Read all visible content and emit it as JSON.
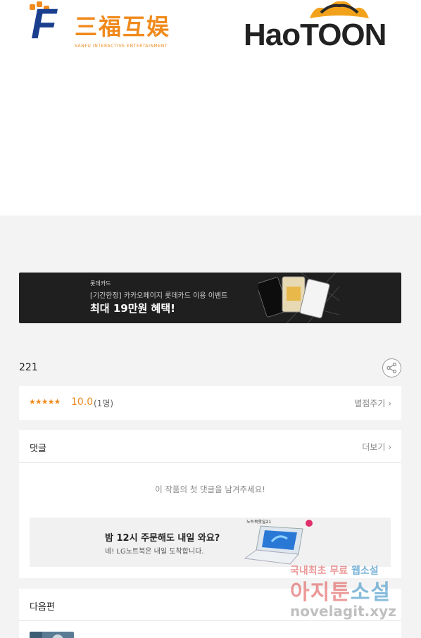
{
  "logos": {
    "sanfu": {
      "mark": "F",
      "name": "三福互娱",
      "tagline": "SANFU INTERACTIVE ENTERTAINMENT"
    },
    "haotoon": {
      "name": "HaoTOON"
    }
  },
  "banner": {
    "brand": "롯데카드",
    "subtitle": "[기간한정] 카카오페이지 롯데카드 이용 이벤트",
    "headline": "최대 19만원 혜택!"
  },
  "episode": {
    "title": "221"
  },
  "rating": {
    "stars": "★★★★★",
    "score": "10.0",
    "count": "(1명)",
    "rate_link": "별점주기"
  },
  "comments": {
    "title": "댓글",
    "more": "더보기",
    "empty_message": "이 작품의 첫 댓글을 남겨주세요!"
  },
  "ad": {
    "headline": "밤 12시 주문해도 내일 와요?",
    "subtitle": "네! LG노트북은 내일 도착합니다.",
    "product_label": "노트북핫딜21"
  },
  "next_episode": {
    "title": "다음편"
  },
  "watermark": {
    "line1_prefix": "국내최초 무료",
    "line1_highlight": "웹소설",
    "line2_prefix": "아지툰",
    "line2_highlight": "소설",
    "line3": "novelagit.xyz"
  },
  "colors": {
    "accent": "#f08a1c",
    "background": "#f3f3f3",
    "banner_bg": "#1f1f1f"
  }
}
